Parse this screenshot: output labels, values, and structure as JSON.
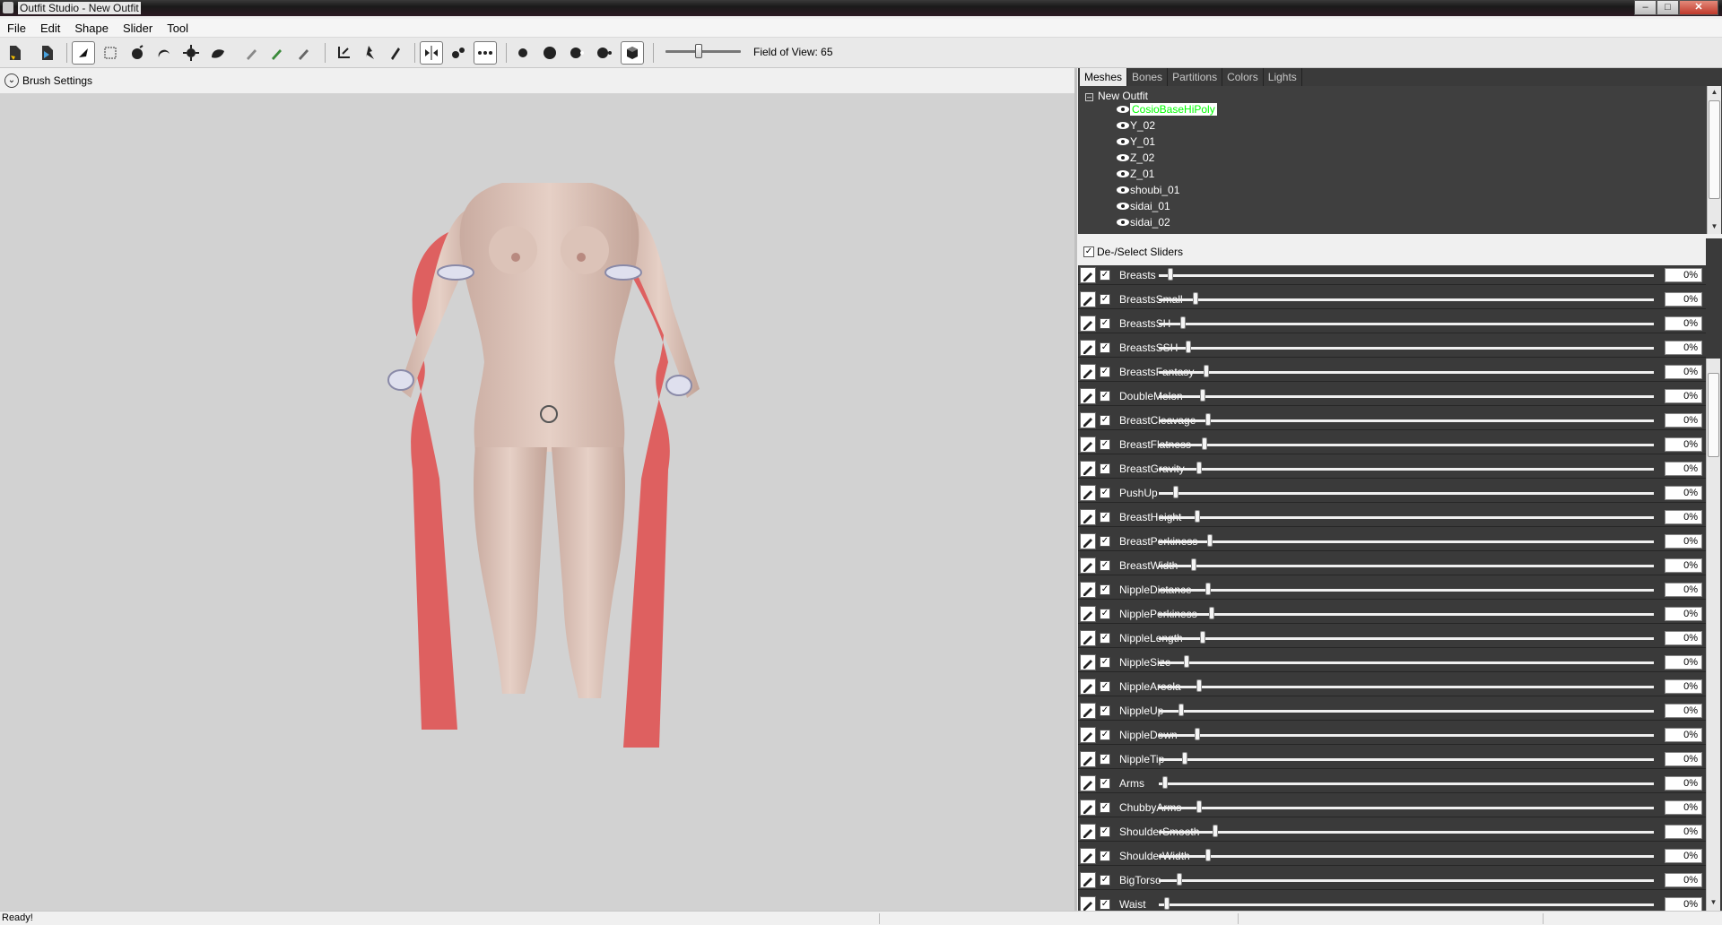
{
  "window": {
    "title": "Outfit Studio - New Outfit"
  },
  "menu": [
    "File",
    "Edit",
    "Shape",
    "Slider",
    "Tool"
  ],
  "toolbar": {
    "fov_label": "Field of View: 65",
    "fov_value": 65
  },
  "brush_settings": {
    "label": "Brush Settings"
  },
  "tabs": [
    "Meshes",
    "Bones",
    "Partitions",
    "Colors",
    "Lights"
  ],
  "meshes": {
    "root": "New Outfit",
    "items": [
      "CosioBaseHiPoly",
      "Y_02",
      "Y_01",
      "Z_02",
      "Z_01",
      "shoubi_01",
      "sidai_01",
      "sidai_02"
    ],
    "selected": "CosioBaseHiPoly"
  },
  "sliders": {
    "deselect_label": "De-/Select Sliders",
    "items": [
      {
        "name": "Breasts",
        "value": "0%"
      },
      {
        "name": "BreastsSmall",
        "value": "0%"
      },
      {
        "name": "BreastsSH",
        "value": "0%"
      },
      {
        "name": "BreastsSSH",
        "value": "0%"
      },
      {
        "name": "BreastsFantasy",
        "value": "0%"
      },
      {
        "name": "DoubleMelon",
        "value": "0%"
      },
      {
        "name": "BreastCleavage",
        "value": "0%"
      },
      {
        "name": "BreastFlatness",
        "value": "0%"
      },
      {
        "name": "BreastGravity",
        "value": "0%"
      },
      {
        "name": "PushUp",
        "value": "0%"
      },
      {
        "name": "BreastHeight",
        "value": "0%"
      },
      {
        "name": "BreastPerkiness",
        "value": "0%"
      },
      {
        "name": "BreastWidth",
        "value": "0%"
      },
      {
        "name": "NippleDistance",
        "value": "0%"
      },
      {
        "name": "NipplePerkiness",
        "value": "0%"
      },
      {
        "name": "NippleLength",
        "value": "0%"
      },
      {
        "name": "NippleSize",
        "value": "0%"
      },
      {
        "name": "NippleAreola",
        "value": "0%"
      },
      {
        "name": "NippleUp",
        "value": "0%"
      },
      {
        "name": "NippleDown",
        "value": "0%"
      },
      {
        "name": "NippleTip",
        "value": "0%"
      },
      {
        "name": "Arms",
        "value": "0%"
      },
      {
        "name": "ChubbyArms",
        "value": "0%"
      },
      {
        "name": "ShoulderSmooth",
        "value": "0%"
      },
      {
        "name": "ShoulderWidth",
        "value": "0%"
      },
      {
        "name": "BigTorso",
        "value": "0%"
      },
      {
        "name": "Waist",
        "value": "0%"
      }
    ]
  },
  "status": {
    "text": "Ready!"
  },
  "colors": {
    "ribbon": "#e23a3a",
    "skin": "#d9bfb3",
    "viewport_bg": "#d2d2d2",
    "selected_mesh": "#00ff00"
  }
}
